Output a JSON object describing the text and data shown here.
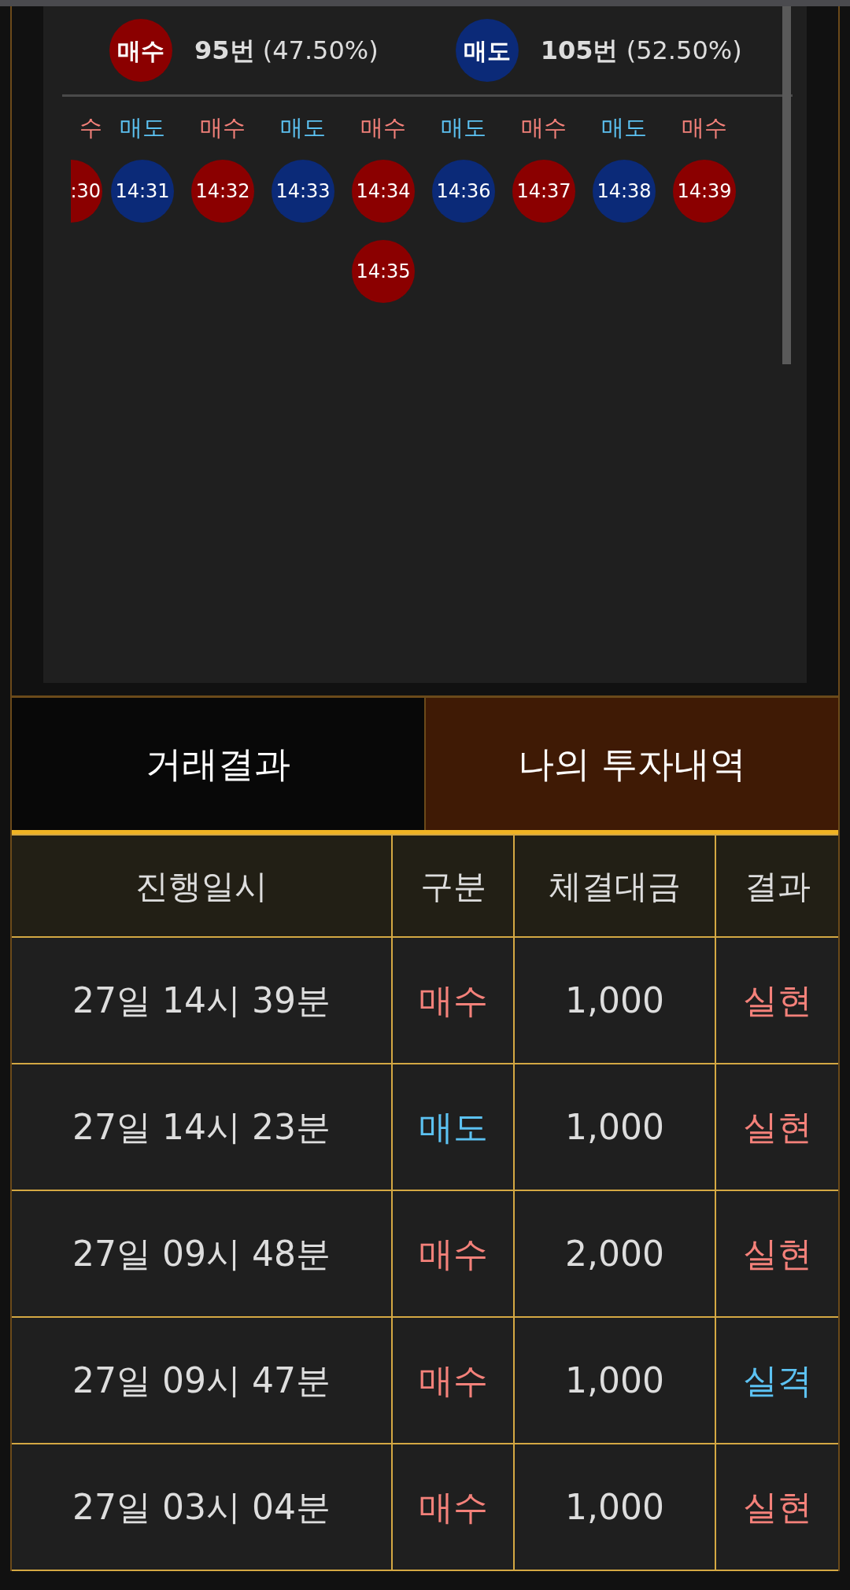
{
  "summary": [
    {
      "label": "매수",
      "kind": "buy",
      "count": "95번",
      "percent": "(47.50%)"
    },
    {
      "label": "매도",
      "kind": "sell",
      "count": "105번",
      "percent": "(52.50%)"
    }
  ],
  "history": [
    {
      "label": "수",
      "kind": "buy",
      "times": [
        ":30"
      ],
      "clipped": true
    },
    {
      "label": "매도",
      "kind": "sell",
      "times": [
        "14:31"
      ]
    },
    {
      "label": "매수",
      "kind": "buy",
      "times": [
        "14:32"
      ]
    },
    {
      "label": "매도",
      "kind": "sell",
      "times": [
        "14:33"
      ]
    },
    {
      "label": "매수",
      "kind": "buy",
      "times": [
        "14:34",
        "14:35"
      ]
    },
    {
      "label": "매도",
      "kind": "sell",
      "times": [
        "14:36"
      ]
    },
    {
      "label": "매수",
      "kind": "buy",
      "times": [
        "14:37"
      ]
    },
    {
      "label": "매도",
      "kind": "sell",
      "times": [
        "14:38"
      ]
    },
    {
      "label": "매수",
      "kind": "buy",
      "times": [
        "14:39"
      ]
    }
  ],
  "tabs": [
    {
      "label": "거래결과",
      "selected": false
    },
    {
      "label": "나의 투자내역",
      "selected": true
    }
  ],
  "table": {
    "columns": [
      "진행일시",
      "구분",
      "체결대금",
      "결과"
    ],
    "rows": [
      {
        "date": "27일 14시 39분",
        "type": {
          "text": "매수",
          "color": "#f4817a"
        },
        "amount": "1,000",
        "result": {
          "text": "실현",
          "color": "#f4817a"
        }
      },
      {
        "date": "27일 14시 23분",
        "type": {
          "text": "매도",
          "color": "#5cc2f2"
        },
        "amount": "1,000",
        "result": {
          "text": "실현",
          "color": "#f4817a"
        }
      },
      {
        "date": "27일 09시 48분",
        "type": {
          "text": "매수",
          "color": "#f4817a"
        },
        "amount": "2,000",
        "result": {
          "text": "실현",
          "color": "#f4817a"
        }
      },
      {
        "date": "27일 09시 47분",
        "type": {
          "text": "매수",
          "color": "#f4817a"
        },
        "amount": "1,000",
        "result": {
          "text": "실격",
          "color": "#5cc2f2"
        }
      },
      {
        "date": "27일 03시 04분",
        "type": {
          "text": "매수",
          "color": "#f4817a"
        },
        "amount": "1,000",
        "result": {
          "text": "실현",
          "color": "#f4817a"
        }
      }
    ]
  }
}
